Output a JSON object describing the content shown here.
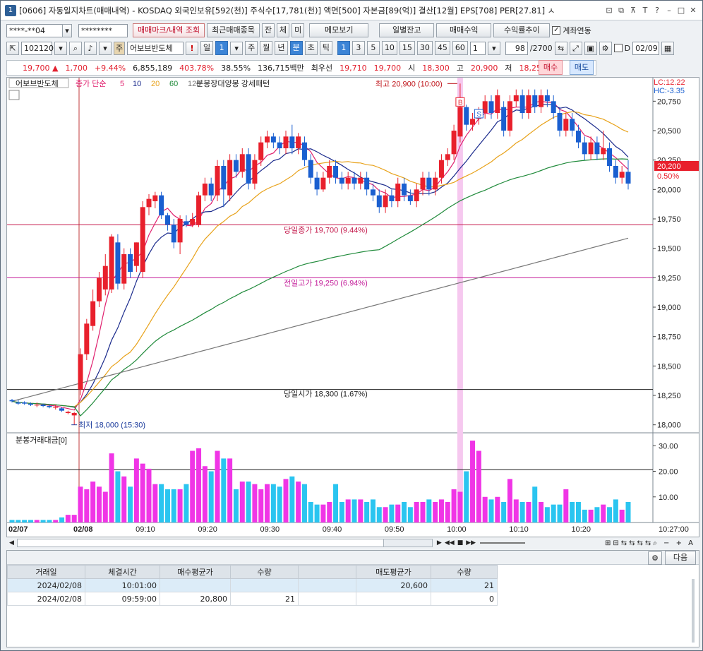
{
  "window": {
    "num": "1",
    "title": "[0606] 자동일지차트(매매내역) - KOSDAQ 외국인보유[592(천)] 주식수[17,781(천)] 액면[500] 자본금[89(억)] 결산[12월] EPS[708] PER[27.81] ㅅ"
  },
  "toolbar1": {
    "account": "****-**04",
    "password": "********",
    "btn_trade_mark": "매매마크/내역 조회",
    "btn_recent_trades": "최근매매종목",
    "btn_jan": "잔",
    "btn_che": "체",
    "btn_mi": "미",
    "btn_memo": "메모보기",
    "btn_daily_balance": "일별잔고",
    "btn_trade_profit": "매매수익",
    "btn_return_trend": "수익률추이",
    "account_link_label": "계좌연동"
  },
  "toolbar2": {
    "code": "102120",
    "stock_name_prefix": "주",
    "stock_name": "어보브반도체",
    "periods": [
      "일",
      "1",
      "주",
      "월",
      "년",
      "분",
      "초",
      "틱"
    ],
    "period_selected": "분",
    "intervals": [
      "1",
      "3",
      "5",
      "10",
      "15",
      "30",
      "45",
      "60"
    ],
    "interval_selected": "1",
    "count_value": "1",
    "bars_shown": "98",
    "bars_total": "/2700",
    "date_value": "02/09",
    "d_label": "D"
  },
  "quote": {
    "price": "19,700",
    "change": "1,700",
    "change_pct": "+9.44%",
    "volume": "6,855,189",
    "vol_ratio": "403.78%",
    "turnover": "38.55%",
    "amount": "136,715백만",
    "best_label": "최우선",
    "best_ask": "19,710",
    "best_bid": "19,700",
    "open_label": "시",
    "open": "18,300",
    "high_label": "고",
    "high": "20,900",
    "low_label": "저",
    "low": "18,250",
    "buy_button": "매수",
    "sell_button": "매도"
  },
  "chart": {
    "stock_label": "어보브반도체",
    "ma_label": "종가 단순",
    "ma_periods": [
      "5",
      "10",
      "20",
      "60",
      "120"
    ],
    "ma_colors": [
      "#e0206e",
      "#1a2a8c",
      "#e8a21a",
      "#1f8a3a",
      "#777777"
    ],
    "pattern_label": "분봉장대양봉 강세패턴",
    "lc": "LC:12.22",
    "hc": "HC:-3.35",
    "current_price_tag": "20,200",
    "current_pct_tag": "0.50%",
    "high_annotation": "최고 20,900 (10:00)",
    "low_annotation": "최저 18,000 (15:30)",
    "close_line_label": "당일종가 19,700 (9.44%)",
    "prev_high_line_label": "전일고가 19,250 (6.94%)",
    "open_line_label": "당일시가 18,300 (1.67%)",
    "buy_mark": "B",
    "sell_mark": "S",
    "price_ticks": [
      "20,750",
      "20,500",
      "20,250",
      "20,000",
      "19,750",
      "19,500",
      "19,250",
      "19,000",
      "18,750",
      "18,500",
      "18,250",
      "18,000"
    ],
    "volume_label": "분봉거래대금[0]",
    "volume_ticks": [
      "30.00",
      "20.00",
      "10.00"
    ],
    "time_labels": [
      "02/07",
      "02/08",
      "09:10",
      "09:20",
      "09:30",
      "09:40",
      "09:50",
      "10:00",
      "10:10",
      "10:20"
    ],
    "time_right": "10:27:00"
  },
  "grid": {
    "next_button": "다음",
    "headers": [
      "거래일",
      "체결시간",
      "매수평균가",
      "수량",
      "",
      "매도평균가",
      "수량"
    ],
    "rows": [
      [
        "2024/02/08",
        "10:01:00",
        "",
        "",
        "",
        "20,600",
        "21"
      ],
      [
        "2024/02/08",
        "09:59:00",
        "20,800",
        "21",
        "",
        "",
        "0"
      ]
    ]
  },
  "chart_data": {
    "type": "candlestick",
    "title": "어보브반도체",
    "ylim": [
      17950,
      20950
    ],
    "candles": [
      [
        18210,
        18200,
        18220,
        18190
      ],
      [
        18190,
        18180,
        18210,
        18170
      ],
      [
        18190,
        18180,
        18200,
        18170
      ],
      [
        18180,
        18170,
        18190,
        18160
      ],
      [
        18170,
        18170,
        18190,
        18150
      ],
      [
        18170,
        18160,
        18180,
        18150
      ],
      [
        18160,
        18150,
        18170,
        18140
      ],
      [
        18150,
        18150,
        18170,
        18130
      ],
      [
        18140,
        18120,
        18150,
        18110
      ],
      [
        18100,
        18110,
        18120,
        18090
      ],
      [
        18080,
        18100,
        18110,
        18000
      ],
      [
        18300,
        18600,
        18650,
        18250
      ],
      [
        18600,
        18860,
        18900,
        18550
      ],
      [
        18840,
        19050,
        19150,
        18800
      ],
      [
        19050,
        19250,
        19300,
        19000
      ],
      [
        19150,
        19350,
        19450,
        19100
      ],
      [
        19150,
        19600,
        19620,
        19120
      ],
      [
        19550,
        19200,
        19620,
        19150
      ],
      [
        19200,
        19450,
        19500,
        19150
      ],
      [
        19450,
        19300,
        19500,
        19250
      ],
      [
        19350,
        19550,
        19550,
        19300
      ],
      [
        19300,
        19850,
        19900,
        19250
      ],
      [
        19850,
        19920,
        19960,
        19780
      ],
      [
        19900,
        19950,
        19980,
        19840
      ],
      [
        19950,
        19780,
        19980,
        19750
      ],
      [
        19780,
        19700,
        19800,
        19650
      ],
      [
        19700,
        19550,
        19750,
        19500
      ],
      [
        19550,
        19750,
        19780,
        19450
      ],
      [
        19730,
        19700,
        19780,
        19680
      ],
      [
        19700,
        19750,
        19800,
        19680
      ],
      [
        19700,
        19950,
        19980,
        19680
      ],
      [
        19950,
        20050,
        20100,
        19900
      ],
      [
        20050,
        19950,
        20100,
        19900
      ],
      [
        19950,
        20200,
        20250,
        19900
      ],
      [
        20200,
        20000,
        20250,
        19850
      ],
      [
        19950,
        20250,
        20300,
        19900
      ],
      [
        20250,
        20150,
        20300,
        20100
      ],
      [
        20150,
        20300,
        20350,
        20100
      ],
      [
        20300,
        20050,
        20350,
        20000
      ],
      [
        20050,
        20250,
        20300,
        20000
      ],
      [
        20250,
        20400,
        20450,
        20200
      ],
      [
        20400,
        20450,
        20500,
        20350
      ],
      [
        20450,
        20400,
        20480,
        20350
      ],
      [
        20400,
        20350,
        20450,
        20300
      ],
      [
        20350,
        20450,
        20500,
        20300
      ],
      [
        20450,
        20350,
        20550,
        20300
      ],
      [
        20350,
        20450,
        20480,
        20300
      ],
      [
        20400,
        20250,
        20450,
        20200
      ],
      [
        20250,
        20100,
        20300,
        20050
      ],
      [
        20100,
        20000,
        20150,
        19950
      ],
      [
        20000,
        20100,
        20150,
        19980
      ],
      [
        20100,
        20200,
        20250,
        20050
      ],
      [
        20200,
        20100,
        20250,
        20050
      ],
      [
        20100,
        20050,
        20150,
        20000
      ],
      [
        20050,
        20100,
        20150,
        20000
      ],
      [
        20100,
        20050,
        20150,
        20000
      ],
      [
        20050,
        20100,
        20150,
        20000
      ],
      [
        20100,
        20000,
        20150,
        19950
      ],
      [
        20000,
        19950,
        20050,
        19900
      ],
      [
        19950,
        19850,
        20000,
        19800
      ],
      [
        19850,
        19950,
        20000,
        19800
      ],
      [
        19950,
        19900,
        20000,
        19850
      ],
      [
        19900,
        20050,
        20100,
        19850
      ],
      [
        20050,
        19950,
        20100,
        19900
      ],
      [
        19950,
        19900,
        20000,
        19870
      ],
      [
        19900,
        20000,
        20050,
        19850
      ],
      [
        20000,
        20100,
        20150,
        19950
      ],
      [
        20100,
        20000,
        20150,
        19950
      ],
      [
        20000,
        20100,
        20150,
        19950
      ],
      [
        20100,
        20250,
        20300,
        20050
      ],
      [
        20250,
        20300,
        20350,
        20200
      ],
      [
        20300,
        20500,
        20550,
        20250
      ],
      [
        20450,
        20700,
        20900,
        20400
      ],
      [
        20700,
        20550,
        20720,
        20500
      ],
      [
        20550,
        20600,
        20650,
        20500
      ],
      [
        20600,
        20650,
        20700,
        20550
      ],
      [
        20650,
        20750,
        20800,
        20600
      ],
      [
        20750,
        20650,
        20800,
        20600
      ],
      [
        20650,
        20800,
        20850,
        20600
      ],
      [
        20700,
        20500,
        20750,
        20450
      ],
      [
        20500,
        20750,
        20800,
        20450
      ],
      [
        20750,
        20800,
        20850,
        20700
      ],
      [
        20800,
        20650,
        20850,
        20600
      ],
      [
        20650,
        20800,
        20850,
        20600
      ],
      [
        20800,
        20700,
        20850,
        20650
      ],
      [
        20700,
        20800,
        20850,
        20650
      ],
      [
        20800,
        20750,
        20850,
        20700
      ],
      [
        20750,
        20650,
        20800,
        20600
      ],
      [
        20650,
        20500,
        20700,
        20450
      ],
      [
        20500,
        20600,
        20650,
        20450
      ],
      [
        20600,
        20500,
        20650,
        20450
      ],
      [
        20500,
        20400,
        20550,
        20350
      ],
      [
        20400,
        20300,
        20450,
        20250
      ],
      [
        20300,
        20400,
        20450,
        20250
      ],
      [
        20400,
        20300,
        20450,
        20250
      ],
      [
        20300,
        20350,
        20500,
        20250
      ],
      [
        20350,
        20200,
        20400,
        20150
      ],
      [
        20200,
        20100,
        20250,
        20050
      ],
      [
        20100,
        20150,
        20200,
        20050
      ],
      [
        20150,
        20050,
        20250,
        20000
      ]
    ],
    "volume": [
      1,
      1,
      1,
      1,
      1,
      1,
      1,
      1,
      2,
      3,
      3,
      14,
      13,
      16,
      14,
      12,
      27,
      20,
      18,
      14,
      25,
      23,
      21,
      15,
      15,
      13,
      13,
      13,
      15,
      28,
      29,
      22,
      20,
      28,
      25,
      25,
      13,
      16,
      16,
      15,
      13,
      15,
      15,
      14,
      17,
      18,
      16,
      15,
      8,
      7,
      7,
      8,
      15,
      8,
      9,
      9,
      9,
      8,
      9,
      6,
      6,
      7,
      7,
      8,
      6,
      8,
      8,
      9,
      8,
      9,
      8,
      13,
      12,
      20,
      32,
      28,
      10,
      9,
      10,
      8,
      17,
      9,
      8,
      8,
      14,
      8,
      6,
      7,
      7,
      13,
      8,
      8,
      5,
      5,
      6,
      7,
      6,
      9,
      5,
      8,
      10,
      8,
      5,
      10,
      4
    ]
  }
}
